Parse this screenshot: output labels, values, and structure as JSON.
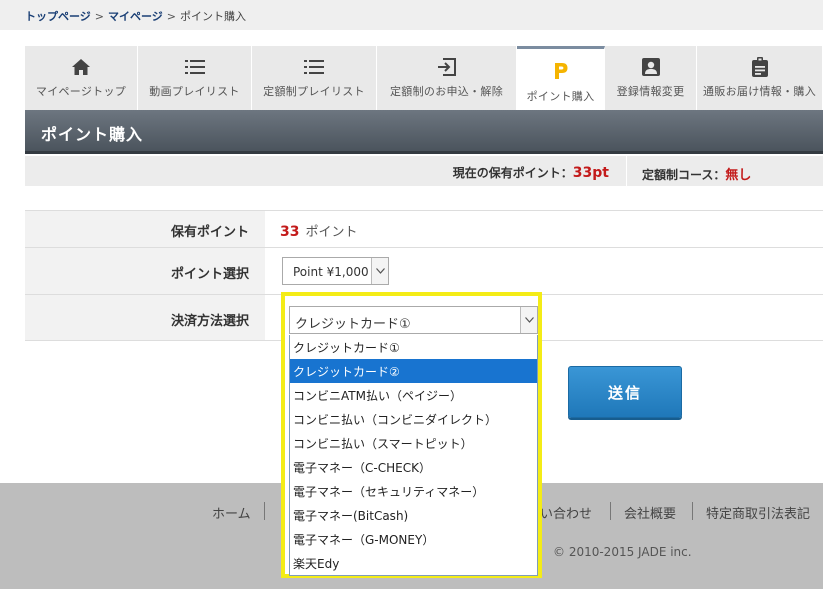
{
  "breadcrumb": {
    "items": [
      "トップページ",
      "マイページ"
    ],
    "separator": ">",
    "current": "ポイント購入"
  },
  "tabs": [
    {
      "label": "マイページトップ",
      "icon": "home-icon"
    },
    {
      "label": "動画プレイリスト",
      "icon": "list-icon"
    },
    {
      "label": "定額制プレイリスト",
      "icon": "list-icon"
    },
    {
      "label": "定額制のお申込・解除",
      "icon": "sign-in-icon"
    },
    {
      "label": "ポイント購入",
      "icon": "point-p-icon",
      "active": true
    },
    {
      "label": "登録情報変更",
      "icon": "user-card-icon"
    },
    {
      "label": "通販お届け情報・購入",
      "icon": "clipboard-icon"
    }
  ],
  "page_title": "ポイント購入",
  "status": {
    "current_label": "現在の保有ポイント：",
    "current_value": "33pt",
    "course_label": "定額制コース：",
    "course_value": "無し"
  },
  "form": {
    "owned_label": "保有ポイント",
    "owned_value": "33",
    "owned_unit": "ポイント",
    "point_label": "ポイント選択",
    "point_selected": "Point ¥1,000",
    "payment_label": "決済方法選択",
    "payment_selected": "クレジットカード①",
    "payment_options": [
      "クレジットカード①",
      "クレジットカード②",
      "コンビニATM払い（ペイジー）",
      "コンビニ払い（コンビニダイレクト）",
      "コンビニ払い（スマートピット）",
      "電子マネー（C-CHECK）",
      "電子マネー（セキュリティマネー）",
      "電子マネー(BitCash)",
      "電子マネー（G-MONEY）",
      "楽天Edy"
    ],
    "highlighted_index": 1,
    "submit_label": "送信"
  },
  "footer": {
    "links": [
      "ホーム",
      "い合わせ",
      "会社概要",
      "特定商取引法表記"
    ],
    "copyright": "© 2010-2015 JADE inc."
  },
  "colors": {
    "accent_red": "#c31a1a",
    "title_bar": "#4b545d",
    "submit_blue": "#1f78b9",
    "highlight_yellow": "#f4ec16",
    "link_navy": "#1a3f75",
    "tab_icon": "#444444",
    "tab_icon_active": "#f5b400"
  }
}
